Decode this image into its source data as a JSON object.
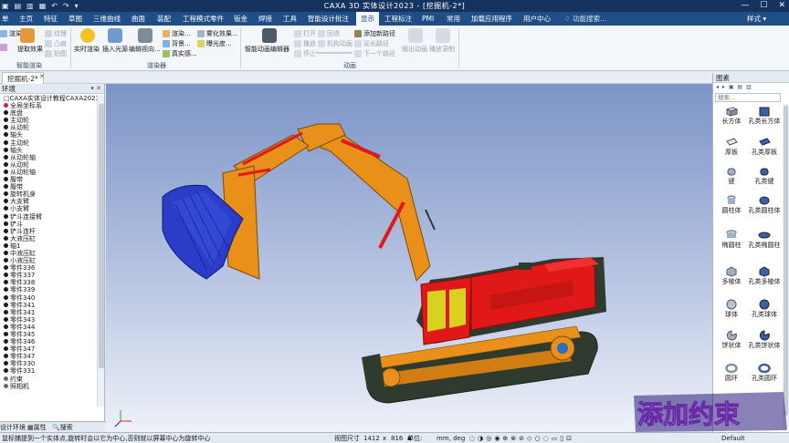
{
  "titlebar": {
    "title": "CAXA 3D 实体设计2023 - [挖掘机-2*]",
    "minimize": "—",
    "maximize": "☐",
    "close": "✕"
  },
  "menu": {
    "tabs": [
      "单",
      "主页",
      "特征",
      "草图",
      "三维曲线",
      "曲面",
      "装配",
      "工程模式零件",
      "钣金",
      "焊接",
      "工具",
      "智能设计批注",
      "显示",
      "工程标注",
      "PMI",
      "常用",
      "加载应用程序",
      "用户中心"
    ],
    "active": "显示",
    "search_label": "功能搜索...",
    "style_label": "样式"
  },
  "ribbon": {
    "group1": {
      "label": "智能渲染",
      "items": [
        "渲染",
        "提取效果",
        "纹理",
        "凸痕",
        "贴图"
      ]
    },
    "group2": {
      "label": "渲染器",
      "items": [
        "实时渲染",
        "插入光源",
        "编辑视向...",
        "渲染...",
        "背景...",
        "真实感...",
        "雾化效果...",
        "曝光度..."
      ]
    },
    "group3": {
      "label": "动画",
      "items": [
        "智能动画编辑器",
        "打开",
        "播放",
        "停止",
        "回退",
        "机构动画",
        "添加新路径",
        "延长路径",
        "下一个路径",
        "输出动画",
        "播放录制"
      ]
    }
  },
  "document": {
    "tab": "挖掘机-2*",
    "close": "✕"
  },
  "left_panel": {
    "title": "环境",
    "tree": [
      "CAXA实体设计教程CAXA2023",
      "全局坐标系",
      "底盘",
      "主动轮",
      "从动轮",
      "轴头",
      "主动轮",
      "轴头",
      "从动轮轴",
      "从动轮",
      "从动轮轴",
      "履带",
      "履带",
      "旋转机身",
      "大支臂",
      "小支臂",
      "铲斗连接臂",
      "铲斗",
      "铲斗连杆",
      "大液压缸",
      "轴1",
      "中液压缸",
      "小液压缸",
      "零件336",
      "零件337",
      "零件338",
      "零件339",
      "零件340",
      "零件341",
      "零件341",
      "零件343",
      "零件344",
      "零件345",
      "零件346",
      "零件347",
      "零件347",
      "零件330",
      "零件331",
      "约束",
      "照相机"
    ],
    "tabs": [
      "设计环境",
      "属性",
      "搜索"
    ]
  },
  "right_panel": {
    "title": "图素",
    "search": "搜索...",
    "shapes": [
      [
        "长方体",
        "孔类长方体"
      ],
      [
        "厚板",
        "孔类厚板"
      ],
      [
        "键",
        "孔类键"
      ],
      [
        "圆柱体",
        "孔类圆柱体"
      ],
      [
        "椭圆柱",
        "孔类椭圆柱"
      ],
      [
        "多棱体",
        "孔类多棱体"
      ],
      [
        "球体",
        "孔类球体"
      ],
      [
        "饼状体",
        "孔类饼状体"
      ],
      [
        "圆环",
        "孔类圆环"
      ]
    ]
  },
  "statusbar": {
    "hint": "鼠标捕提到一个实体点,旋转时会以它为中心,否则就以屏幕中心为旋转中心",
    "view_size_label": "视图尺寸",
    "view_w": "1412",
    "view_x": "x",
    "view_h": "816",
    "unit_label": "单位:",
    "unit_value": "mm, deg",
    "default": "Default"
  },
  "watermark": {
    "text": "添加约束"
  },
  "colors": {
    "title_bg": "#14345f",
    "menu_bg": "#1f4e86",
    "excavator_orange": "#e8901a",
    "cab_red": "#e01818",
    "bucket_blue": "#2a3cc8",
    "track_dark": "#2e3b2e"
  }
}
